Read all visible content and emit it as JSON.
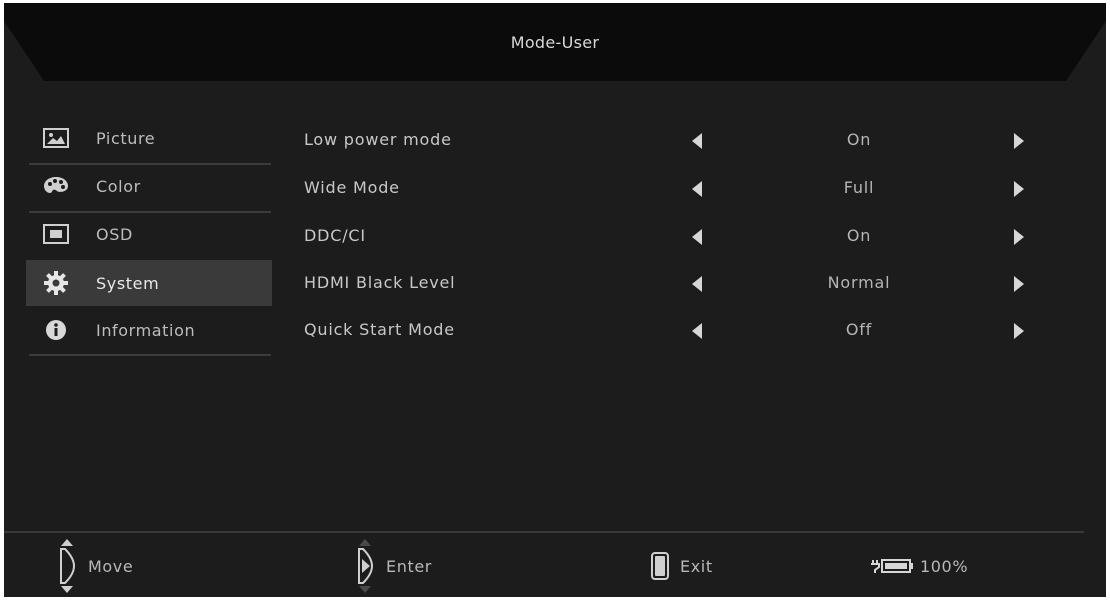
{
  "title": "Mode-User",
  "sidebar": {
    "items": [
      {
        "label": "Picture",
        "icon": "picture-icon"
      },
      {
        "label": "Color",
        "icon": "palette-icon"
      },
      {
        "label": "OSD",
        "icon": "osd-icon"
      },
      {
        "label": "System",
        "icon": "gear-icon",
        "active": true
      },
      {
        "label": "Information",
        "icon": "info-icon"
      }
    ]
  },
  "settings": [
    {
      "label": "Low power mode",
      "value": "On"
    },
    {
      "label": "Wide Mode",
      "value": "Full"
    },
    {
      "label": "DDC/CI",
      "value": "On"
    },
    {
      "label": "HDMI Black Level",
      "value": "Normal"
    },
    {
      "label": "Quick Start Mode",
      "value": "Off"
    }
  ],
  "footer": {
    "move_label": "Move",
    "enter_label": "Enter",
    "exit_label": "Exit",
    "battery_label": "100%"
  },
  "colors": {
    "background": "#1c1c1c",
    "titlebar": "#0d0d0d",
    "active_item": "#3a3a3a",
    "text": "#c8c8c8"
  }
}
